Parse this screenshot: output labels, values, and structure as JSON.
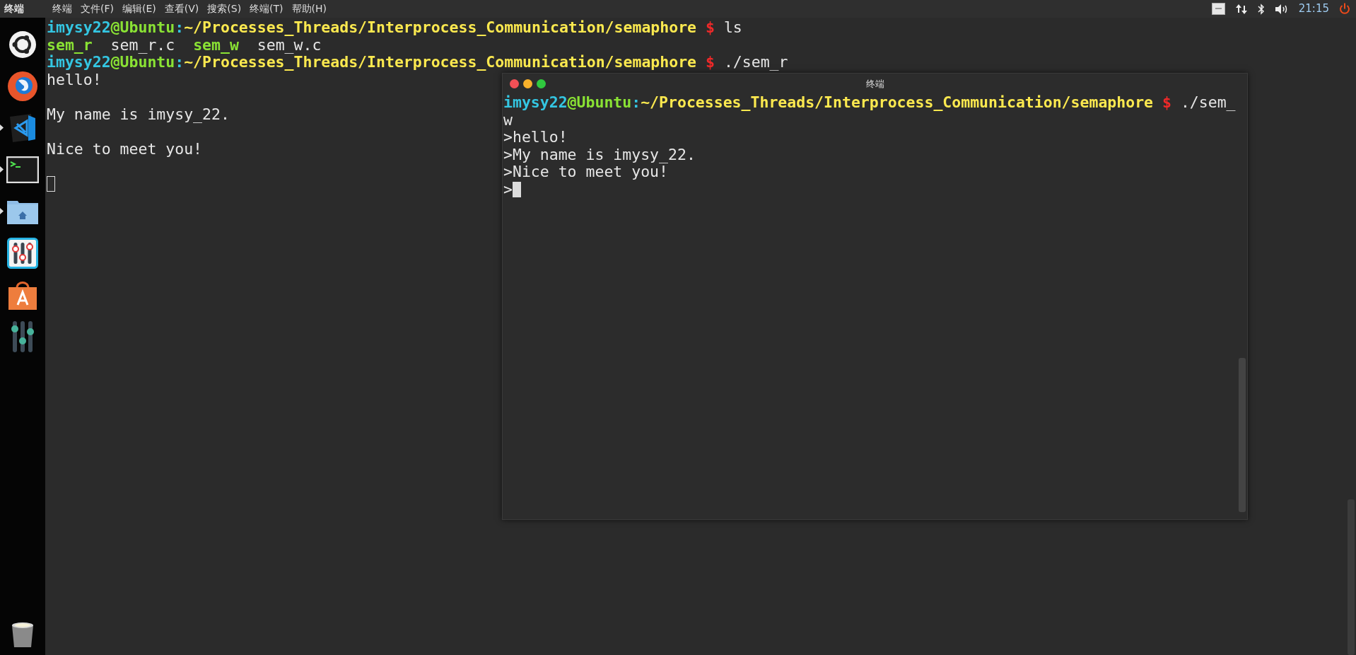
{
  "top_bar": {
    "app_title": "终端",
    "menu": [
      "终端",
      "文件(F)",
      "编辑(E)",
      "查看(V)",
      "搜索(S)",
      "终端(T)",
      "帮助(H)"
    ],
    "clock": "21:15"
  },
  "launcher": {
    "items": [
      {
        "kind": "ubuntu",
        "running": false
      },
      {
        "kind": "firefox",
        "running": false
      },
      {
        "kind": "vscode",
        "running": true
      },
      {
        "kind": "terminal",
        "running": true
      },
      {
        "kind": "files",
        "running": true
      },
      {
        "kind": "tweak",
        "running": false
      },
      {
        "kind": "store",
        "running": false
      },
      {
        "kind": "mixer",
        "running": false
      }
    ],
    "trash": {
      "kind": "trash"
    }
  },
  "main_terminal": {
    "focused": false,
    "lines": [
      {
        "kind": "text",
        "segments": [
          {
            "kind": "user",
            "text": "imysy22"
          },
          {
            "kind": "host",
            "text": "@Ubuntu"
          },
          {
            "kind": "colon",
            "text": ":"
          },
          {
            "kind": "path",
            "text": "~/Processes_Threads/Interprocess_Communication/semaphore"
          },
          {
            "kind": "sign",
            "text": " $"
          },
          {
            "kind": "plain",
            "text": " ls"
          }
        ]
      },
      {
        "kind": "text",
        "segments": [
          {
            "kind": "exec",
            "text": "sem_r"
          },
          {
            "kind": "plain",
            "text": "  sem_r.c  "
          },
          {
            "kind": "exec",
            "text": "sem_w"
          },
          {
            "kind": "plain",
            "text": "  sem_w.c"
          }
        ]
      },
      {
        "kind": "text",
        "segments": [
          {
            "kind": "user",
            "text": "imysy22"
          },
          {
            "kind": "host",
            "text": "@Ubuntu"
          },
          {
            "kind": "colon",
            "text": ":"
          },
          {
            "kind": "path",
            "text": "~/Processes_Threads/Interprocess_Communication/semaphore"
          },
          {
            "kind": "sign",
            "text": " $"
          },
          {
            "kind": "plain",
            "text": " ./sem_r"
          }
        ]
      },
      {
        "kind": "text",
        "segments": [
          {
            "kind": "plain",
            "text": "hello!"
          }
        ]
      },
      {
        "kind": "blank"
      },
      {
        "kind": "text",
        "segments": [
          {
            "kind": "plain",
            "text": "My name is imysy_22."
          }
        ]
      },
      {
        "kind": "blank"
      },
      {
        "kind": "text",
        "segments": [
          {
            "kind": "plain",
            "text": "Nice to meet you!"
          }
        ]
      },
      {
        "kind": "blank"
      },
      {
        "kind": "blank"
      }
    ]
  },
  "terminal_window": {
    "title": "终端",
    "focused": true,
    "lines": [
      {
        "kind": "text",
        "segments": [
          {
            "kind": "user",
            "text": "imysy22"
          },
          {
            "kind": "host",
            "text": "@Ubuntu"
          },
          {
            "kind": "colon",
            "text": ":"
          },
          {
            "kind": "path",
            "text": "~/Processes_Threads/Interprocess_Communication/semaphore"
          },
          {
            "kind": "sign",
            "text": " $"
          },
          {
            "kind": "plain",
            "text": " ./sem_"
          }
        ]
      },
      {
        "kind": "text",
        "segments": [
          {
            "kind": "plain",
            "text": "w"
          }
        ]
      },
      {
        "kind": "text",
        "segments": [
          {
            "kind": "plain",
            "text": ">hello!"
          }
        ]
      },
      {
        "kind": "text",
        "segments": [
          {
            "kind": "plain",
            "text": ">My name is imysy_22."
          }
        ]
      },
      {
        "kind": "text",
        "segments": [
          {
            "kind": "plain",
            "text": ">Nice to meet you!"
          }
        ]
      },
      {
        "kind": "text",
        "segments": [
          {
            "kind": "plain",
            "text": ">"
          }
        ]
      }
    ]
  }
}
